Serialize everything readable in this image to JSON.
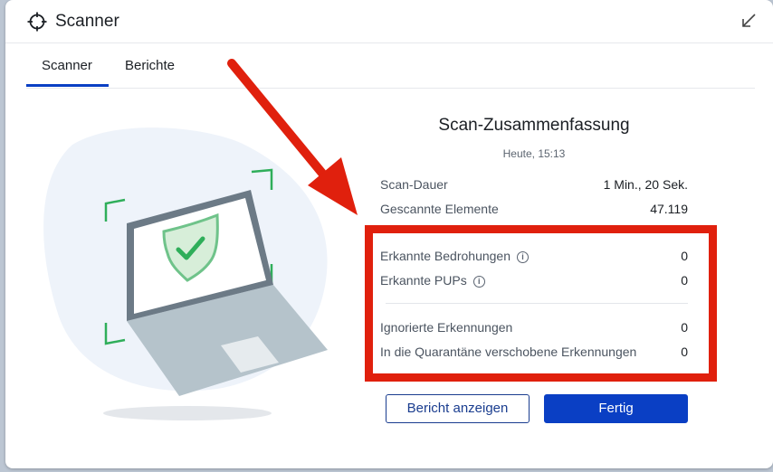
{
  "window": {
    "title": "Scanner"
  },
  "tabs": [
    {
      "label": "Scanner",
      "active": true
    },
    {
      "label": "Berichte",
      "active": false
    }
  ],
  "summary": {
    "title": "Scan-Zusammenfassung",
    "date": "Heute, 15:13",
    "rows": [
      {
        "label": "Scan-Dauer",
        "value": "1 Min., 20 Sek."
      },
      {
        "label": "Gescannte Elemente",
        "value": "47.119"
      }
    ],
    "detections": [
      {
        "label": "Erkannte Bedrohungen",
        "value": "0",
        "info": true
      },
      {
        "label": "Erkannte PUPs",
        "value": "0",
        "info": true
      }
    ],
    "other": [
      {
        "label": "Ignorierte Erkennungen",
        "value": "0"
      },
      {
        "label": "In die Quarantäne verschobene Erkennungen",
        "value": "0"
      }
    ]
  },
  "buttons": {
    "report": "Bericht anzeigen",
    "done": "Fertig"
  },
  "info_glyph": "i",
  "colors": {
    "accent": "#0a3fc4",
    "highlight": "#e0200d",
    "shield_green": "#2fae5a"
  }
}
